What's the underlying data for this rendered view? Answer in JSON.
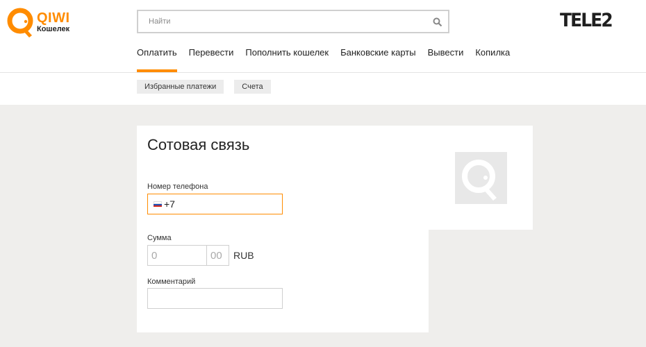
{
  "brand": {
    "name": "QIWI",
    "subtitle": "Кошелек",
    "accent_color": "#ff8c00",
    "icon": "qiwi-logo-icon"
  },
  "search": {
    "placeholder": "Найти",
    "value": "",
    "icon": "search-icon"
  },
  "operator_logo": {
    "text": "TELE2"
  },
  "nav": {
    "items": [
      {
        "label": "Оплатить",
        "active": true
      },
      {
        "label": "Перевести",
        "active": false
      },
      {
        "label": "Пополнить кошелек",
        "active": false
      },
      {
        "label": "Банковские карты",
        "active": false
      },
      {
        "label": "Вывести",
        "active": false
      },
      {
        "label": "Копилка",
        "active": false
      }
    ]
  },
  "subnav": {
    "items": [
      {
        "label": "Избранные платежи"
      },
      {
        "label": "Счета"
      }
    ]
  },
  "form": {
    "title": "Сотовая связь",
    "phone": {
      "label": "Номер телефона",
      "prefix": "+7",
      "flag": "russia-flag-icon"
    },
    "amount": {
      "label": "Сумма",
      "int_placeholder": "0",
      "frac_placeholder": "00",
      "currency": "RUB"
    },
    "comment": {
      "label": "Комментарий",
      "value": ""
    },
    "provider_icon": "qiwi-provider-icon"
  }
}
